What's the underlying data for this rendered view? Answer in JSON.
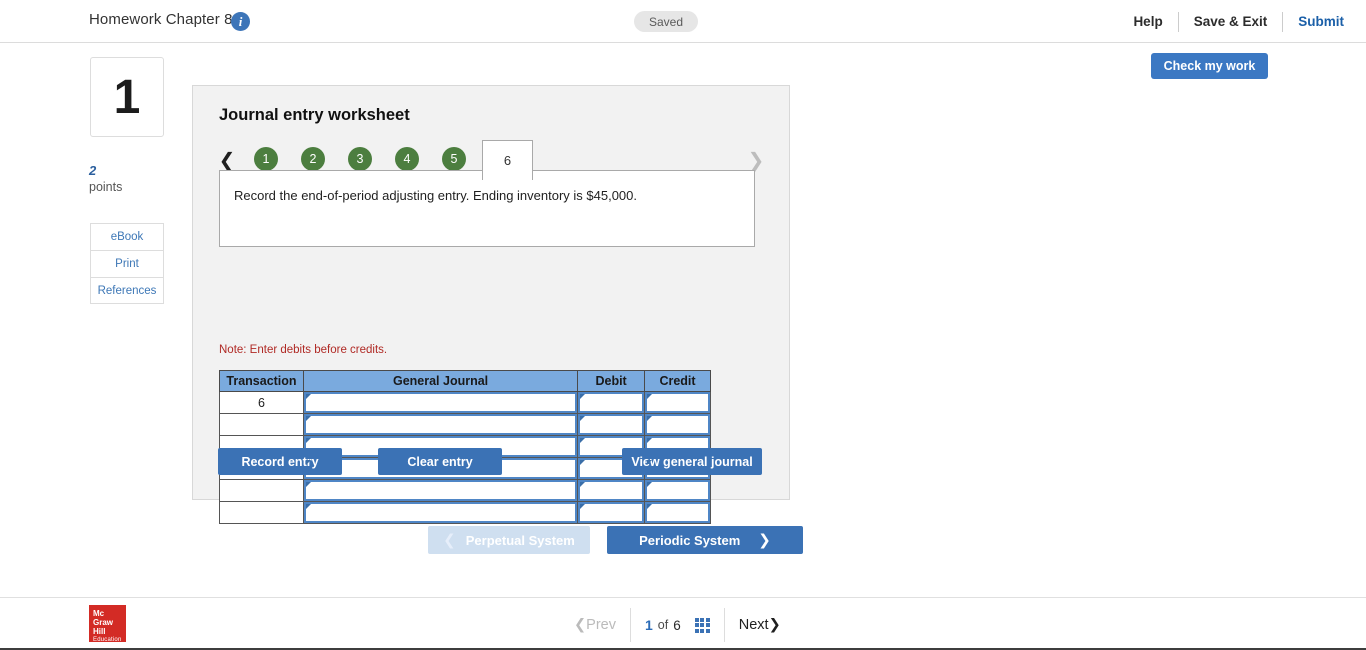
{
  "topbar": {
    "title": "Homework Chapter 8",
    "info_icon": "info-icon",
    "status": "Saved",
    "help": "Help",
    "save_exit": "Save & Exit",
    "submit": "Submit"
  },
  "check_work": {
    "label": "Check my work"
  },
  "sidebar": {
    "question_number": "1",
    "points_value": "2",
    "points_label": "points",
    "buttons": [
      {
        "label": "eBook"
      },
      {
        "label": "Print"
      },
      {
        "label": "References"
      }
    ]
  },
  "worksheet": {
    "title": "Journal entry worksheet",
    "prev_arrow": "chevron-left-icon",
    "next_arrow": "chevron-right-icon",
    "tabs": [
      {
        "label": "1",
        "state": "complete"
      },
      {
        "label": "2",
        "state": "complete"
      },
      {
        "label": "3",
        "state": "complete"
      },
      {
        "label": "4",
        "state": "complete"
      },
      {
        "label": "5",
        "state": "complete"
      },
      {
        "label": "6",
        "state": "active"
      }
    ],
    "prompt": "Record the end-of-period adjusting entry. Ending inventory is $45,000.",
    "note": "Note: Enter debits before credits."
  },
  "journal_table": {
    "columns": [
      "Transaction",
      "General Journal",
      "Debit",
      "Credit"
    ],
    "rows": [
      {
        "transaction": "6",
        "general_journal": "",
        "debit": "",
        "credit": ""
      },
      {
        "transaction": "",
        "general_journal": "",
        "debit": "",
        "credit": ""
      },
      {
        "transaction": "",
        "general_journal": "",
        "debit": "",
        "credit": ""
      },
      {
        "transaction": "",
        "general_journal": "",
        "debit": "",
        "credit": ""
      },
      {
        "transaction": "",
        "general_journal": "",
        "debit": "",
        "credit": ""
      },
      {
        "transaction": "",
        "general_journal": "",
        "debit": "",
        "credit": ""
      }
    ]
  },
  "actions": {
    "record_entry": "Record entry",
    "clear_entry": "Clear entry",
    "view_journal": "View general journal"
  },
  "system_nav": {
    "prev_label": "Perpetual System",
    "prev_icon": "chevron-left-icon",
    "next_label": "Periodic System",
    "next_icon": "chevron-right-icon"
  },
  "footer": {
    "logo_line1": "Mc",
    "logo_line2": "Graw",
    "logo_line3": "Hill",
    "logo_line4": "Education",
    "prev": "Prev",
    "current_page": "1",
    "of": "of",
    "total_pages": "6",
    "grid_icon": "grid-view-icon",
    "next": "Next"
  },
  "colors": {
    "accent_blue": "#3b72b5",
    "table_header_blue": "#7aaade",
    "tab_green": "#4c7e3f",
    "note_red": "#b02a25",
    "logo_red": "#d32b25",
    "disabled_blue": "#cfdff0"
  }
}
